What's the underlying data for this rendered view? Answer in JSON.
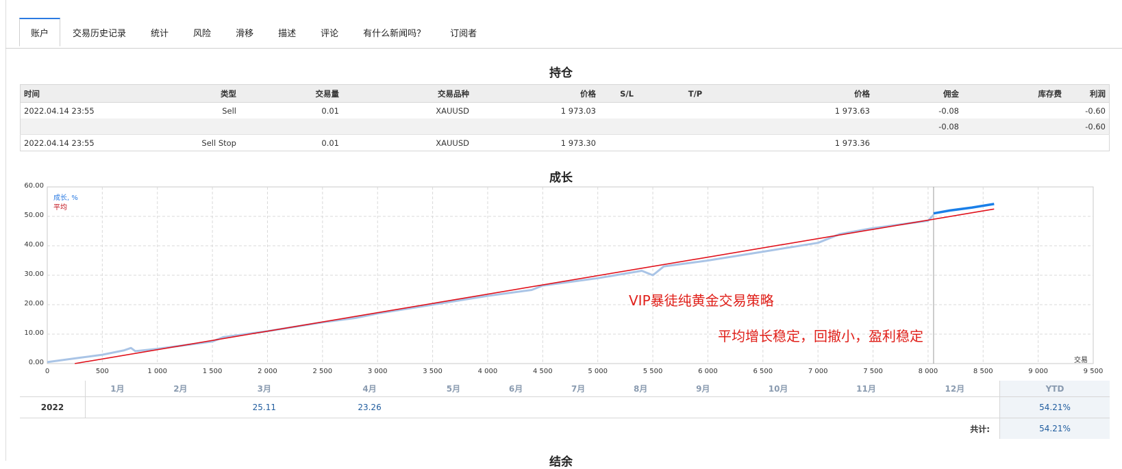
{
  "tabs": [
    "账户",
    "交易历史记录",
    "统计",
    "风险",
    "滑移",
    "描述",
    "评论",
    "有什么新闻吗？",
    "订阅者"
  ],
  "positions": {
    "title": "持仓",
    "headers": [
      "时间",
      "类型",
      "交易量",
      "交易品种",
      "价格",
      "S/L",
      "T/P",
      "价格",
      "佣金",
      "库存费",
      "利润"
    ],
    "rows": [
      {
        "time": "2022.04.14 23:55",
        "type": "Sell",
        "volume": "0.01",
        "symbol": "XAUUSD",
        "price": "1 973.03",
        "sl": "",
        "tp": "",
        "price2": "1 973.63",
        "commission": "-0.08",
        "swap": "",
        "profit": "-0.60"
      },
      {
        "time": "",
        "type": "",
        "volume": "",
        "symbol": "",
        "price": "",
        "sl": "",
        "tp": "",
        "price2": "",
        "commission": "-0.08",
        "swap": "",
        "profit": "-0.60"
      },
      {
        "time": "2022.04.14 23:55",
        "type": "Sell Stop",
        "volume": "0.01",
        "symbol": "XAUUSD",
        "price": "1 973.30",
        "sl": "",
        "tp": "",
        "price2": "1 973.36",
        "commission": "",
        "swap": "",
        "profit": ""
      }
    ]
  },
  "growth": {
    "title": "成长",
    "legend_growth": "成长, %",
    "legend_avg": "平均",
    "x_axis_label": "交易",
    "annotation1": "VIP暴徒纯黄金交易策略",
    "annotation2": "平均增长稳定，回撤小，盈利稳定",
    "yticks": [
      "60.00",
      "50.00",
      "40.00",
      "30.00",
      "20.00",
      "10.00",
      "0.00"
    ],
    "xticks": [
      "0",
      "500",
      "1 000",
      "1 500",
      "2 000",
      "2 500",
      "3 000",
      "3 500",
      "4 000",
      "4 500",
      "5 000",
      "5 500",
      "6 000",
      "6 500",
      "7 000",
      "7 500",
      "8 000",
      "8 500",
      "9 000",
      "9 500"
    ]
  },
  "chart_data": {
    "type": "line",
    "xlabel": "交易",
    "ylabel": "",
    "xlim": [
      0,
      9500
    ],
    "ylim": [
      0,
      60
    ],
    "grid": true,
    "legend": "top-left",
    "series": [
      {
        "name": "成长, %",
        "color": "#a9c4e6",
        "x": [
          0,
          300,
          500,
          700,
          760,
          800,
          1000,
          1300,
          1500,
          1600,
          2000,
          2500,
          2800,
          3000,
          3500,
          4000,
          4400,
          4500,
          5000,
          5400,
          5500,
          5600,
          6000,
          6500,
          7000,
          7200,
          7500,
          8000,
          8050
        ],
        "y": [
          0.5,
          2.0,
          3.0,
          4.5,
          5.3,
          4.2,
          5.0,
          6.5,
          7.5,
          9.0,
          11.0,
          14.0,
          15.5,
          17.0,
          20.0,
          23.0,
          25.0,
          26.5,
          29.0,
          31.5,
          30.0,
          33.0,
          35.0,
          38.0,
          41.0,
          44.0,
          46.0,
          48.5,
          50.5
        ]
      },
      {
        "name": "",
        "color": "#1a7fe8",
        "x": [
          8050,
          8200,
          8400,
          8600
        ],
        "y": [
          51.0,
          52.0,
          53.0,
          54.2
        ]
      },
      {
        "name": "平均",
        "color": "#e0101a",
        "x": [
          250,
          8600
        ],
        "y": [
          0.0,
          52.5
        ]
      }
    ]
  },
  "monthly": {
    "months": [
      "1月",
      "2月",
      "3月",
      "4月",
      "5月",
      "6月",
      "7月",
      "8月",
      "9月",
      "10月",
      "11月",
      "12月"
    ],
    "ytd_label": "YTD",
    "year": "2022",
    "values": [
      "",
      "",
      "25.11",
      "23.26",
      "",
      "",
      "",
      "",
      "",
      "",
      "",
      ""
    ],
    "ytd": "54.21%",
    "total_label": "共计:",
    "total": "54.21%"
  },
  "next_section_title": "结余"
}
